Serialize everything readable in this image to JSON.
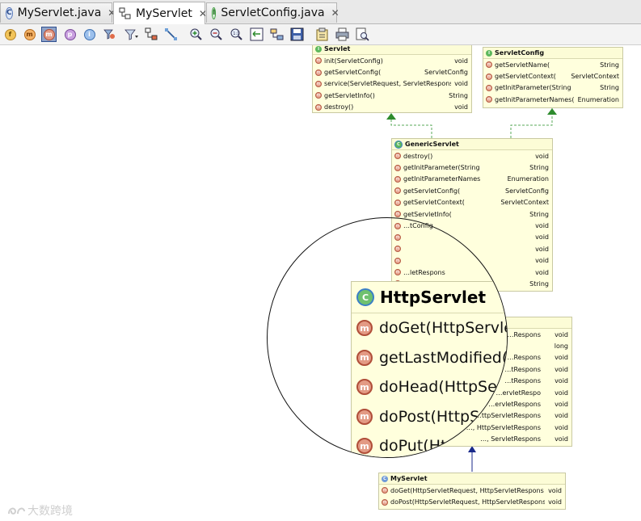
{
  "tabs": [
    {
      "label": "MyServlet.java",
      "icon": "java-class-icon",
      "close": "✕",
      "active": false
    },
    {
      "label": "MyServlet",
      "icon": "class-diagram-icon",
      "close": "✕",
      "active": true
    },
    {
      "label": "ServletConfig.java",
      "icon": "java-interface-icon",
      "close": "✕",
      "active": false
    }
  ],
  "toolbar": [
    {
      "name": "show-fields-icon",
      "glyph": "f"
    },
    {
      "name": "show-constructors-icon",
      "glyph": "m"
    },
    {
      "name": "show-methods-icon",
      "glyph": "m",
      "pressed": true
    },
    {
      "name": "show-properties-icon",
      "glyph": "p"
    },
    {
      "name": "show-inner-classes-icon",
      "glyph": "i"
    },
    {
      "name": "change-visibility-icon",
      "glyph": ""
    },
    {
      "name": "filter-icon",
      "glyph": ""
    },
    {
      "name": "layout-icon",
      "glyph": ""
    },
    {
      "name": "show-dependencies-icon",
      "glyph": ""
    },
    {
      "name": "zoom-in-icon",
      "glyph": ""
    },
    {
      "name": "zoom-out-icon",
      "glyph": ""
    },
    {
      "name": "actual-size-icon",
      "glyph": ""
    },
    {
      "name": "fit-content-icon",
      "glyph": ""
    },
    {
      "name": "apply-layout-icon",
      "glyph": ""
    },
    {
      "name": "save-diagram-icon",
      "glyph": ""
    },
    {
      "name": "export-icon",
      "glyph": ""
    },
    {
      "name": "print-icon",
      "glyph": ""
    },
    {
      "name": "print-preview-icon",
      "glyph": ""
    }
  ],
  "diagram": {
    "servlet": {
      "title": "Servlet",
      "rows": [
        {
          "name": "init(ServletConfig)",
          "type": "void"
        },
        {
          "name": "getServletConfig(",
          "type": "ServletConfig"
        },
        {
          "name": "service(ServletRequest, ServletRespons",
          "type": "void"
        },
        {
          "name": "getServletInfo()",
          "type": "String"
        },
        {
          "name": "destroy()",
          "type": "void"
        }
      ]
    },
    "servletConfig": {
      "title": "ServletConfig",
      "rows": [
        {
          "name": "getServletName(",
          "type": "String"
        },
        {
          "name": "getServletContext(",
          "type": "ServletContext"
        },
        {
          "name": "getInitParameter(String",
          "type": "String"
        },
        {
          "name": "getInitParameterNames(",
          "type": "Enumeration"
        }
      ]
    },
    "genericServlet": {
      "title": "GenericServlet",
      "rows": [
        {
          "name": "destroy()",
          "type": "void"
        },
        {
          "name": "getInitParameter(String",
          "type": "String"
        },
        {
          "name": "getInitParameterNames",
          "type": "Enumeration"
        },
        {
          "name": "getServletConfig(",
          "type": "ServletConfig"
        },
        {
          "name": "getServletContext(",
          "type": "ServletContext"
        },
        {
          "name": "getServletInfo(",
          "type": "String"
        },
        {
          "name": "…tConfig",
          "type": "void"
        },
        {
          "name": "",
          "type": "void"
        },
        {
          "name": "",
          "type": "void"
        },
        {
          "name": "",
          "type": "void"
        },
        {
          "name": "…letRespons",
          "type": "void"
        },
        {
          "name": "",
          "type": "String"
        }
      ]
    },
    "httpServletTail": {
      "rows": [
        {
          "name": "…Respons",
          "type": "void"
        },
        {
          "name": "",
          "type": "long"
        },
        {
          "name": "…Respons",
          "type": "void"
        },
        {
          "name": "…tRespons",
          "type": "void"
        },
        {
          "name": "…tRespons",
          "type": "void"
        },
        {
          "name": "…ervletRespo",
          "type": "void"
        },
        {
          "name": "…ervletRespons",
          "type": "void"
        },
        {
          "name": "…ttpServletRespons",
          "type": "void"
        },
        {
          "name": "…, HttpServletRespons",
          "type": "void"
        },
        {
          "name": "…, ServletRespons",
          "type": "void"
        }
      ]
    },
    "myServlet": {
      "title": "MyServlet",
      "rows": [
        {
          "name": "doGet(HttpServletRequest, HttpServletRespons",
          "type": "void"
        },
        {
          "name": "doPost(HttpServletRequest, HttpServletRespons",
          "type": "void"
        }
      ]
    }
  },
  "magnifier": {
    "title": "HttpServlet",
    "rows": [
      "doGet(HttpServle",
      "getLastModified(",
      "doHead(HttpSer",
      "doPost(HttpS",
      "doPut(Ht"
    ]
  },
  "watermark": "大数跨境"
}
